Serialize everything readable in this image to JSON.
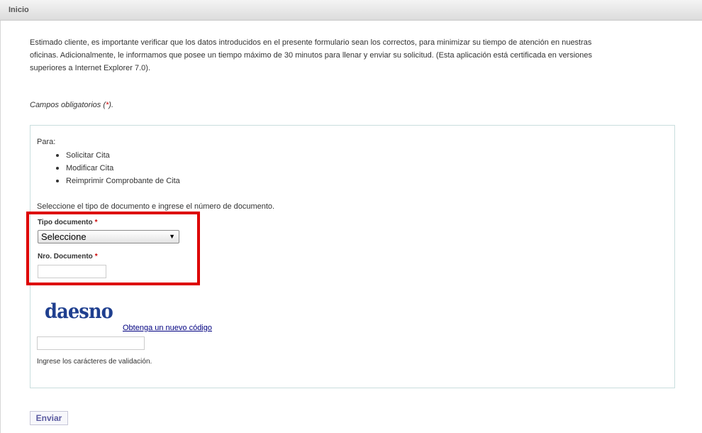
{
  "header": {
    "title": "Inicio"
  },
  "intro": {
    "line1": "Estimado cliente, es importante verificar que los datos introducidos en el presente formulario sean los correctos, para minimizar su tiempo de atención en nuestras",
    "line2": "oficinas. Adicionalmente, le informamos que posee un tiempo máximo de 30 minutos para llenar y enviar su solicitud. (Esta aplicación está certificada en versiones",
    "line3": "superiores a Internet Explorer 7.0)."
  },
  "required_note": {
    "prefix": "Campos obligatorios (",
    "star": "*",
    "suffix": ")."
  },
  "panel": {
    "para_label": "Para:",
    "options": [
      "Solicitar Cita",
      "Modificar Cita",
      "Reimprimir Comprobante de Cita"
    ],
    "instruction": "Seleccione el tipo de documento e ingrese el número de documento."
  },
  "form": {
    "doc_type_label": "Tipo documento",
    "doc_number_label": "Nro. Documento",
    "required_mark": "*",
    "doc_type_selected": "Seleccione",
    "doc_type_arrow": "▼",
    "doc_number_value": ""
  },
  "captcha": {
    "text": "daesno",
    "new_code_link": "Obtenga un nuevo código",
    "input_value": "",
    "help": "Ingrese los carácteres de validación."
  },
  "submit": {
    "label": "Enviar"
  },
  "colors": {
    "required_star": "#cc0000",
    "highlight_border": "#dd0000",
    "captcha_text": "#1f3f8f",
    "link": "#000080"
  }
}
